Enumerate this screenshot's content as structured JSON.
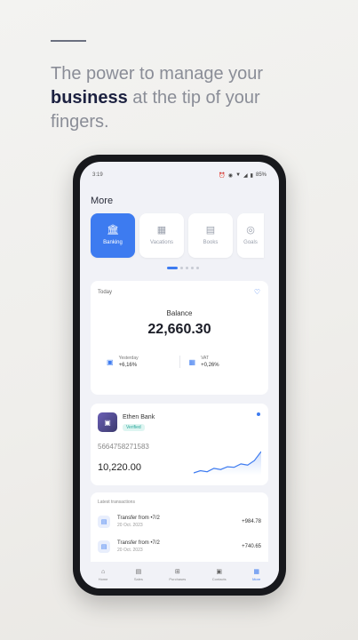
{
  "headline": {
    "part1": "The power to manage your",
    "bold": "business",
    "part2": "at the tip of your fingers."
  },
  "status_bar": {
    "time": "3:19",
    "icons": [
      "alarm-icon",
      "eye-icon",
      "wifi-icon",
      "signal-icon",
      "battery-icon"
    ],
    "battery": "85%"
  },
  "screen": {
    "title": "More",
    "tiles": [
      {
        "label": "Banking",
        "icon": "bank-icon",
        "active": true
      },
      {
        "label": "Vacations",
        "icon": "calendar-icon",
        "active": false
      },
      {
        "label": "Books",
        "icon": "book-icon",
        "active": false
      },
      {
        "label": "Goals",
        "icon": "target-icon",
        "active": false
      }
    ],
    "pager_active": 0,
    "pager_count": 5
  },
  "balance_card": {
    "period": "Today",
    "label": "Balance",
    "amount": "22,660.30",
    "stats": [
      {
        "name": "Yesterday",
        "value": "+6,16%"
      },
      {
        "name": "VAT",
        "value": "+0,26%"
      }
    ]
  },
  "account_card": {
    "name": "Ethen Bank",
    "badge": "Verified",
    "number": "5664758271583",
    "amount": "10,220.00",
    "sparkline": [
      3,
      3.4,
      3.2,
      3.8,
      3.6,
      4.1,
      4.0,
      4.6,
      4.4,
      5.2,
      6.8
    ]
  },
  "transactions": {
    "title": "Latest transactions",
    "rows": [
      {
        "title": "Transfer from •7/2",
        "date": "20 Oct. 2023",
        "amount": "+984.78"
      },
      {
        "title": "Transfer from •7/2",
        "date": "20 Oct. 2023",
        "amount": "+740.65"
      }
    ]
  },
  "bottom_nav": [
    {
      "label": "Home",
      "icon": "home-icon",
      "active": false
    },
    {
      "label": "Sales",
      "icon": "receipt-icon",
      "active": false
    },
    {
      "label": "Purchases",
      "icon": "cart-icon",
      "active": false
    },
    {
      "label": "Contacts",
      "icon": "contacts-icon",
      "active": false
    },
    {
      "label": "More",
      "icon": "grid-icon",
      "active": true
    }
  ],
  "colors": {
    "accent": "#3d7bf0",
    "headline_bold": "#1c2140",
    "headline_light": "#8a8d97",
    "phone_frame": "#17181c"
  }
}
